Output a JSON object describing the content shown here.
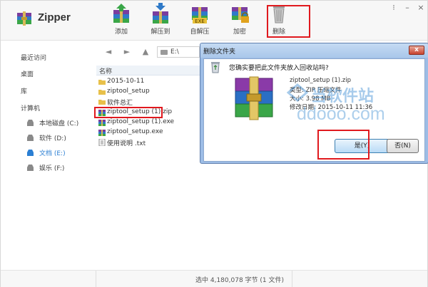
{
  "app": {
    "title": "Zipper"
  },
  "toolbar": {
    "add": "添加",
    "extract_to": "解压到",
    "self_extract": "自解压",
    "encrypt": "加密",
    "delete": "删除",
    "exe_badge": "EXE"
  },
  "sidebar": {
    "recent": "最近访问",
    "desktop": "桌面",
    "library": "库",
    "computer": "计算机",
    "drives": [
      {
        "label": "本地磁盘 (C:)"
      },
      {
        "label": "软件 (D:)"
      },
      {
        "label": "文档 (E:)"
      },
      {
        "label": "娱乐 (F:)"
      }
    ],
    "active_drive": "文档 (E:)"
  },
  "address": {
    "path": "E:\\"
  },
  "files": {
    "column_name": "名称",
    "items": [
      {
        "name": "2015-10-11",
        "type": "folder"
      },
      {
        "name": "ziptool_setup",
        "type": "folder"
      },
      {
        "name": "软件总汇",
        "type": "folder"
      },
      {
        "name": "ziptool_setup (1).zip",
        "type": "zip"
      },
      {
        "name": "ziptool_setup (1).exe",
        "type": "exe"
      },
      {
        "name": "ziptool_setup.exe",
        "type": "exe"
      },
      {
        "name": "使用说明 .txt",
        "type": "txt"
      }
    ]
  },
  "status": {
    "text": "选中  4,180,078 字节 (1 文件)"
  },
  "dialog": {
    "title": "删除文件夹",
    "close": "x",
    "question": "您确实要把此文件夹放入回收站吗?",
    "file_name": "ziptool_setup (1).zip",
    "file_type": "类型: ZIP 压缩文件",
    "file_size": "大小: 3.98 MB",
    "file_modified": "修改日期: 2015-10-11 11:36",
    "yes": "是(Y)",
    "no": "否(N)"
  },
  "watermark": {
    "line1": "当软件站",
    "line2": "ddooo.com"
  },
  "colors": {
    "accent": "#2b7fd3",
    "highlight_box": "#e0191e",
    "dialog_frame": "#9dbde6"
  }
}
